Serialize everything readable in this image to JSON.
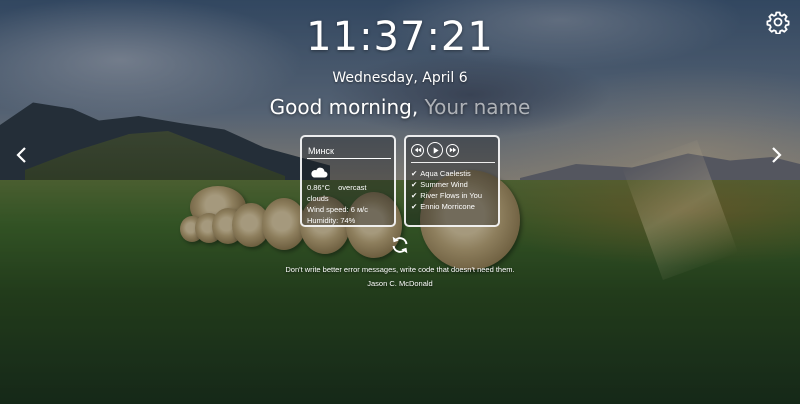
{
  "clock": {
    "time": "11:37:21"
  },
  "date": {
    "text": "Wednesday, April 6"
  },
  "greeting": {
    "prefix": "Good morning,",
    "name": "Your name"
  },
  "weather": {
    "city": "Минск",
    "icon": "cloud-icon",
    "temperature": "0.86°C",
    "description": "overcast clouds",
    "wind": "Wind speed: 6 м/с",
    "humidity": "Humidity: 74%"
  },
  "player": {
    "controls": [
      "previous-icon",
      "play-icon",
      "next-icon"
    ],
    "tracks": [
      {
        "title": "Aqua Caelestis"
      },
      {
        "title": "Summer Wind"
      },
      {
        "title": "River Flows in You"
      },
      {
        "title": "Ennio Morricone"
      }
    ]
  },
  "quote": {
    "text": "Don't write better error messages, write code that doesn't need them.",
    "author": "Jason C. McDonald"
  },
  "icons": {
    "settings": "gear-icon",
    "prev_slide": "chevron-left-icon",
    "next_slide": "chevron-right-icon",
    "refresh_quote": "refresh-icon"
  },
  "colors": {
    "text": "#ffffff",
    "muted_name": "#c9cdd6"
  }
}
